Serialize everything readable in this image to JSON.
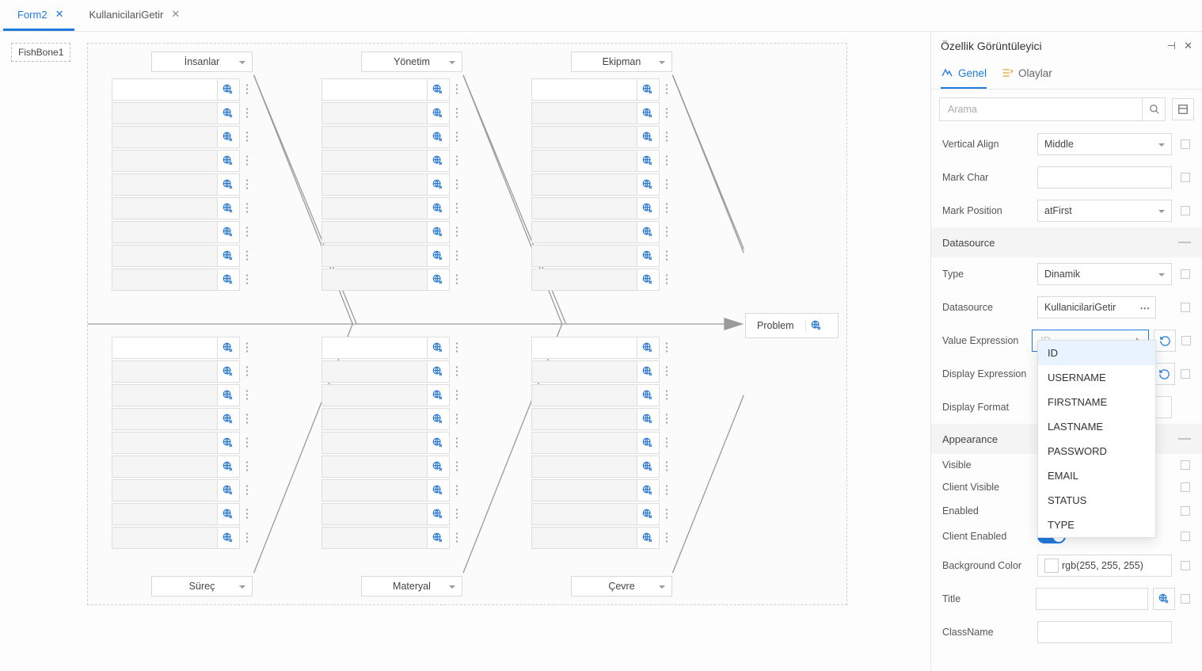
{
  "tabs": [
    {
      "label": "Form2",
      "active": true
    },
    {
      "label": "KullanicilariGetir",
      "active": false
    }
  ],
  "fishbone_tag": "FishBone1",
  "categories_top": [
    "İnsanlar",
    "Yönetim",
    "Ekipman"
  ],
  "categories_bottom": [
    "Süreç",
    "Materyal",
    "Çevre"
  ],
  "problem_label": "Problem",
  "panel": {
    "title": "Özellik Görüntüleyici",
    "tabs": {
      "general": "Genel",
      "events": "Olaylar"
    },
    "search_placeholder": "Arama",
    "sections": {
      "datasource": "Datasource",
      "appearance": "Appearance"
    },
    "props": {
      "vertical_align": {
        "label": "Vertical Align",
        "value": "Middle"
      },
      "mark_char": {
        "label": "Mark Char",
        "value": ""
      },
      "mark_position": {
        "label": "Mark Position",
        "value": "atFirst"
      },
      "type": {
        "label": "Type",
        "value": "Dinamik"
      },
      "datasource": {
        "label": "Datasource",
        "value": "KullanicilariGetir"
      },
      "value_expression": {
        "label": "Value Expression",
        "placeholder": "ID",
        "value": ""
      },
      "display_expression": {
        "label": "Display Expression"
      },
      "display_format": {
        "label": "Display Format",
        "value": ""
      },
      "visible": {
        "label": "Visible"
      },
      "client_visible": {
        "label": "Client Visible"
      },
      "enabled": {
        "label": "Enabled"
      },
      "client_enabled": {
        "label": "Client Enabled"
      },
      "background_color": {
        "label": "Background Color",
        "value": "rgb(255, 255, 255)"
      },
      "title": {
        "label": "Title",
        "value": ""
      },
      "class_name": {
        "label": "ClassName",
        "value": ""
      }
    },
    "dropdown_options": [
      "ID",
      "USERNAME",
      "FIRSTNAME",
      "LASTNAME",
      "PASSWORD",
      "EMAIL",
      "STATUS",
      "TYPE"
    ]
  }
}
